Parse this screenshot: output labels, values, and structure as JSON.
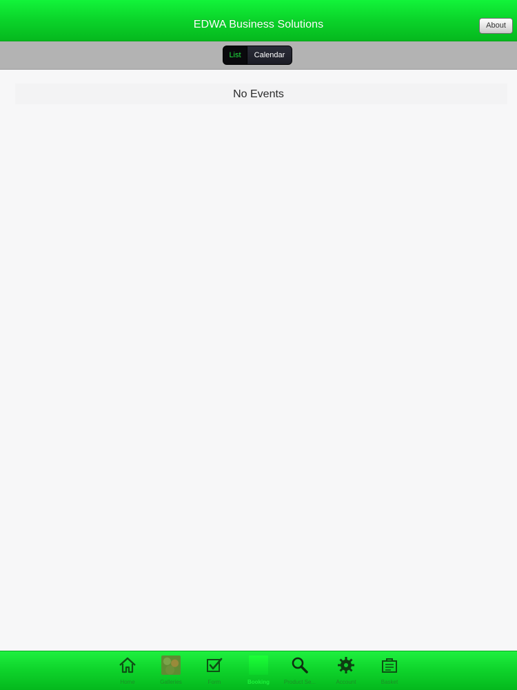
{
  "header": {
    "title": "EDWA Business Solutions",
    "about_label": "About"
  },
  "segment": {
    "list_label": "List",
    "calendar_label": "Calendar",
    "selected": "List"
  },
  "content": {
    "empty_message": "No Events"
  },
  "tabbar": {
    "items": [
      {
        "label": "Home",
        "icon": "home-icon"
      },
      {
        "label": "Galleries",
        "icon": "gallery-icon"
      },
      {
        "label": "Form",
        "icon": "checkbox-icon"
      },
      {
        "label": "Booking",
        "icon": "booking-icon",
        "active": true
      },
      {
        "label": "Product Se...",
        "icon": "search-icon"
      },
      {
        "label": "Account",
        "icon": "gear-icon"
      },
      {
        "label": "Basket",
        "icon": "basket-icon"
      }
    ]
  },
  "colors": {
    "brand_green": "#0bd62b",
    "active_green": "#1df13c",
    "segment_bar": "#b3b3b3"
  }
}
